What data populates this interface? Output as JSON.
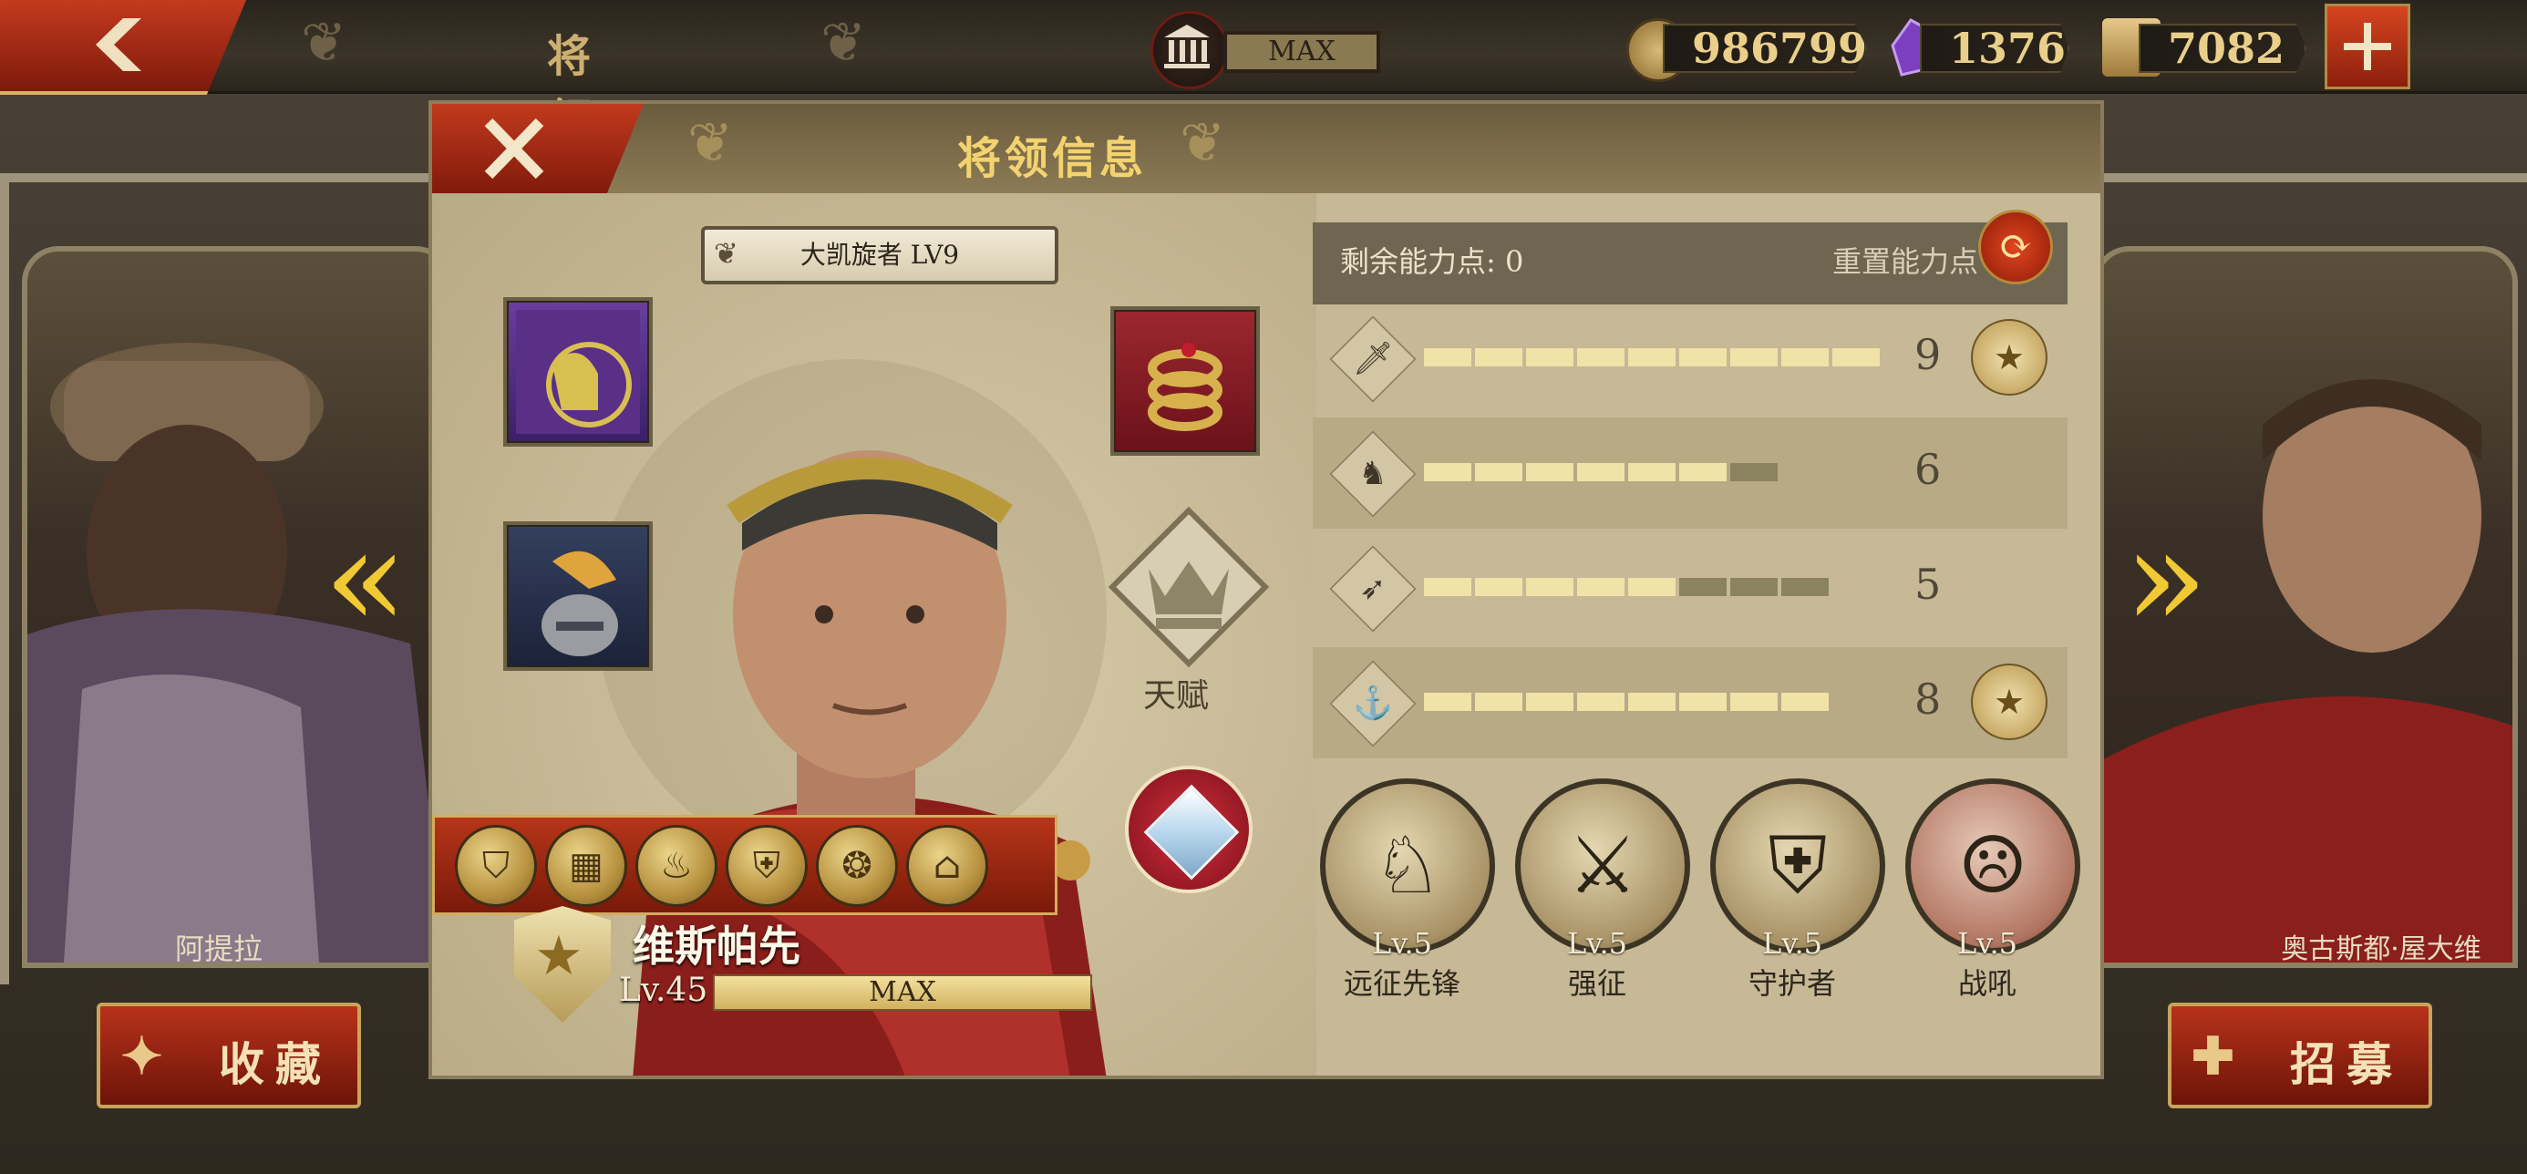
{
  "header": {
    "back_icon": "chevron-left-icon",
    "title": "将 领",
    "museum_label": "MAX",
    "resources": [
      {
        "icon": "coin-icon",
        "value": "986799",
        "color": "#b8924a"
      },
      {
        "icon": "purple-gem-icon",
        "value": "1376",
        "color": "#7b3fbf"
      },
      {
        "icon": "spqr-eagle-icon",
        "value": "7082",
        "color": "#c9a45a"
      }
    ],
    "plus_icon": "plus-icon"
  },
  "side_generals": {
    "left_name": "阿提拉",
    "right_name": "奥古斯都·屋大维"
  },
  "bottom_buttons": {
    "favorite_label": "收藏",
    "recruit_label": "招募"
  },
  "panel": {
    "title": "将领信息",
    "title_badge": "大凯旋者 LV9",
    "talent_label": "天赋",
    "hero": {
      "name": "维斯帕先",
      "level": "Lv.45",
      "exp_label": "MAX"
    },
    "equipment": [
      {
        "name": "vespasian-banner",
        "color": "#5a2f86"
      },
      {
        "name": "gold-snake-ring",
        "color": "#8e1f27"
      },
      {
        "name": "plumed-helmet",
        "color": "#2b3150"
      }
    ],
    "skill_icons": [
      "shield-skill-icon",
      "gate-skill-icon",
      "fire-skill-icon",
      "armor-skill-icon",
      "shield-wings-skill-icon",
      "house-skill-icon"
    ],
    "stats": {
      "remaining_label": "剩余能力点: 0",
      "reset_label": "重置能力点",
      "rows": [
        {
          "icon": "sword-icon",
          "value": "9",
          "filled": 9,
          "total": 9,
          "medal": true
        },
        {
          "icon": "horse-icon",
          "value": "6",
          "filled": 6,
          "total": 7,
          "medal": false
        },
        {
          "icon": "bow-icon",
          "value": "5",
          "filled": 5,
          "total": 8,
          "medal": false
        },
        {
          "icon": "anchor-icon",
          "value": "8",
          "filled": 8,
          "total": 8,
          "medal": true
        }
      ],
      "bar_fill_color": "#f1e2a8",
      "bar_empty_color": "#8b8360"
    },
    "passives": [
      {
        "icon": "cavalry-knight-icon",
        "level": "Lv.5",
        "name": "远征先锋"
      },
      {
        "icon": "sword-gold-icon",
        "level": "Lv.5",
        "name": "强征"
      },
      {
        "icon": "guardian-shield-icon",
        "level": "Lv.5",
        "name": "守护者"
      },
      {
        "icon": "war-cry-icon",
        "level": "Lv.5",
        "name": "战吼"
      }
    ]
  }
}
